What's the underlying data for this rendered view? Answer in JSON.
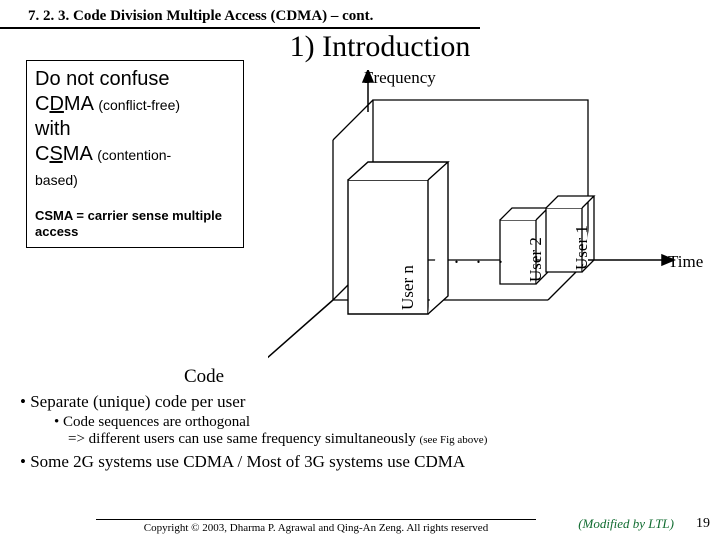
{
  "header": "7. 2. 3. Code Division Multiple Access (CDMA) – cont.",
  "title": "1) Introduction",
  "note": {
    "l1a": "Do not confuse",
    "l2a": "C",
    "l2u": "D",
    "l2b": "MA ",
    "l2small": "(conflict-free)",
    "l3": "with",
    "l4a": "C",
    "l4u": "S",
    "l4b": "MA ",
    "l4small1": "(contention-",
    "l5small": "based)",
    "def": "CSMA = carrier sense multiple access"
  },
  "axes": {
    "freq": "Frequency",
    "time": "Time",
    "code": "Code",
    "user_n": "User n",
    "user_2": "User 2",
    "user_1": "User 1",
    "dots": ". . ."
  },
  "bullets": {
    "b1": "• Separate (unique) code per user",
    "b2": "• Code sequences are orthogonal",
    "b2b_a": "=> different users can use same frequency simultaneously ",
    "b2b_b": "(see Fig above)",
    "b3": "• Some 2G systems use CDMA / Most of 3G systems use CDMA"
  },
  "footer": {
    "copyright": "Copyright © 2003, Dharma P. Agrawal and Qing-An Zeng. All rights reserved",
    "modified": "(Modified by LTL)",
    "page": "19"
  }
}
